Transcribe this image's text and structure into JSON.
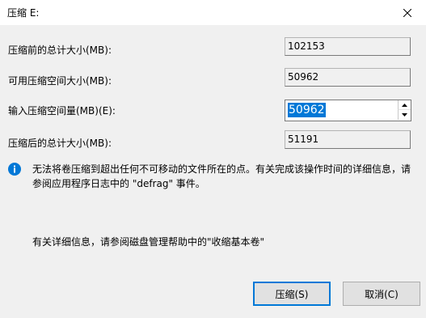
{
  "window": {
    "title": "压缩 E:",
    "close_icon": "close-icon"
  },
  "fields": {
    "total_size_before": {
      "label": "压缩前的总计大小(MB):",
      "value": "102153"
    },
    "available_shrink": {
      "label": "可用压缩空间大小(MB):",
      "value": "50962"
    },
    "shrink_amount": {
      "label": "输入压缩空间量(MB)(E):",
      "value": "50962"
    },
    "total_size_after": {
      "label": "压缩后的总计大小(MB):",
      "value": "51191"
    }
  },
  "info": {
    "icon": "info-icon",
    "color": "#0078d7",
    "text": "无法将卷压缩到超出任何不可移动的文件所在的点。有关完成该操作时间的详细信息，请参阅应用程序日志中的 \"defrag\" 事件。"
  },
  "help": {
    "text": "有关详细信息，请参阅磁盘管理帮助中的\"收缩基本卷\""
  },
  "buttons": {
    "shrink_label": "压缩(S)",
    "cancel_label": "取消(C)"
  },
  "colors": {
    "accent": "#0078d7",
    "background": "#f0f0f0"
  }
}
